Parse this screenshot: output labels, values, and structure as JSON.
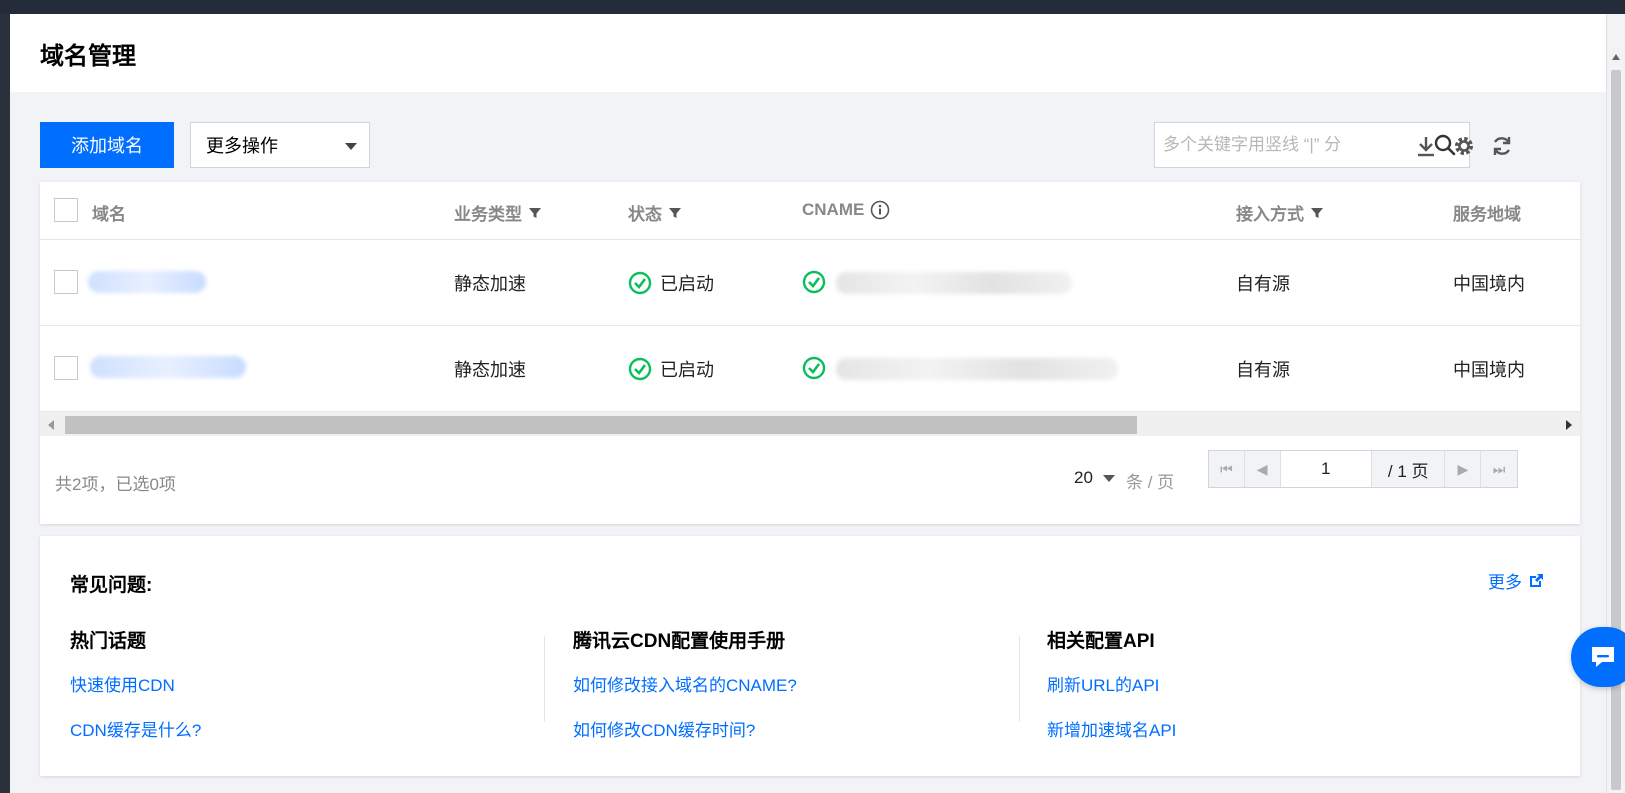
{
  "dialog": {
    "title": "域名管理"
  },
  "toolbar": {
    "add_label": "添加域名",
    "more_ops_label": "更多操作",
    "search_placeholder": "多个关键字用竖线 “|” 分"
  },
  "table": {
    "columns": {
      "domain": "域名",
      "biz_type": "业务类型",
      "status": "状态",
      "cname": "CNAME",
      "access": "接入方式",
      "region": "服务地域"
    },
    "rows": [
      {
        "biz_type": "静态加速",
        "status": "已启动",
        "access": "自有源",
        "region": "中国境内"
      },
      {
        "biz_type": "静态加速",
        "status": "已启动",
        "access": "自有源",
        "region": "中国境内"
      }
    ]
  },
  "pager": {
    "total_text": "共2项，已选0项",
    "page_size": "20",
    "unit": "条 / 页",
    "current_page": "1",
    "total_pages": "/ 1 页"
  },
  "faq": {
    "title": "常见问题:",
    "more_label": "更多",
    "columns": [
      {
        "heading": "热门话题",
        "links": [
          "快速使用CDN",
          "CDN缓存是什么?"
        ]
      },
      {
        "heading": "腾讯云CDN配置使用手册",
        "links": [
          "如何修改接入域名的CNAME?",
          "如何修改CDN缓存时间?"
        ]
      },
      {
        "heading": "相关配置API",
        "links": [
          "刷新URL的API",
          "新增加速域名API"
        ]
      }
    ]
  },
  "colors": {
    "primary": "#006eff",
    "success": "#0abf5b",
    "page_bg": "#f2f3f7"
  }
}
